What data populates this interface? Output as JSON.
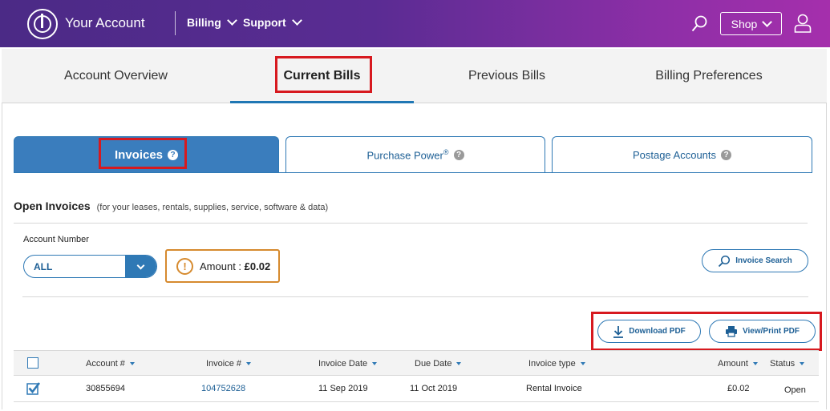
{
  "header": {
    "brand": "Your Account",
    "nav": [
      {
        "label": "Billing"
      },
      {
        "label": "Support"
      }
    ],
    "shop_label": "Shop"
  },
  "main_tabs": [
    {
      "label": "Account Overview"
    },
    {
      "label": "Current Bills",
      "active": true
    },
    {
      "label": "Previous Bills"
    },
    {
      "label": "Billing Preferences"
    }
  ],
  "sub_tabs": [
    {
      "label": "Invoices",
      "active": true
    },
    {
      "label": "Purchase Power",
      "sup": "®"
    },
    {
      "label": "Postage Accounts"
    }
  ],
  "open_invoices": {
    "title": "Open Invoices",
    "subtitle": "(for your leases, rentals, supplies, service, software & data)"
  },
  "filters": {
    "account_number_label": "Account Number",
    "account_number_value": "ALL",
    "amount_label": "Amount :",
    "amount_value": "£0.02",
    "invoice_search_label": "Invoice Search"
  },
  "actions": {
    "download_pdf": "Download PDF",
    "view_print_pdf": "View/Print PDF"
  },
  "table": {
    "columns": [
      "Account #",
      "Invoice #",
      "Invoice Date",
      "Due Date",
      "Invoice type",
      "Amount",
      "Status"
    ],
    "rows": [
      {
        "account": "30855694",
        "invoice": "104752628",
        "invoice_date": "11 Sep 2019",
        "due_date": "11 Oct 2019",
        "type": "Rental Invoice",
        "amount": "£0.02",
        "status": "Open",
        "checked": true
      }
    ]
  },
  "colors": {
    "header_gradient_start": "#4b2a86",
    "header_gradient_end": "#a52fac",
    "accent_blue": "#2f79b5",
    "highlight_red": "#d7191f",
    "amount_orange": "#d68a2e"
  }
}
